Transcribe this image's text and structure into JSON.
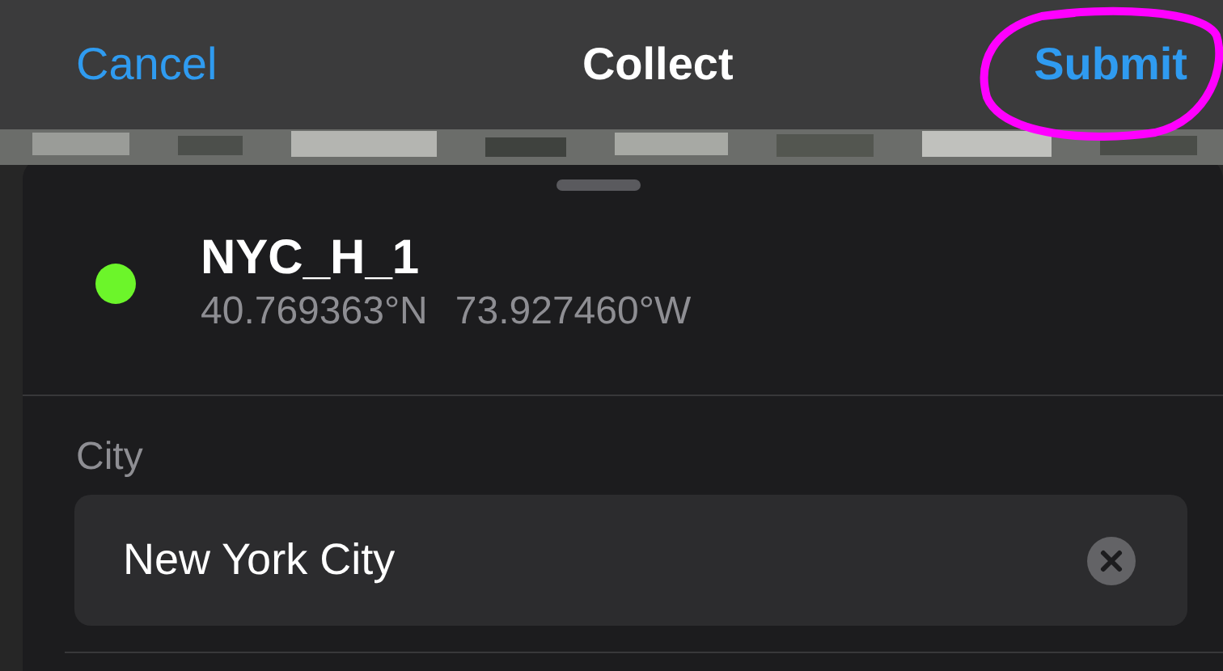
{
  "nav": {
    "cancel": "Cancel",
    "title": "Collect",
    "submit": "Submit"
  },
  "feature": {
    "name": "NYC_H_1",
    "latitude": "40.769363°N",
    "longitude": "73.927460°W",
    "color": "#6cf52a"
  },
  "field": {
    "label": "City",
    "value": "New York City"
  }
}
